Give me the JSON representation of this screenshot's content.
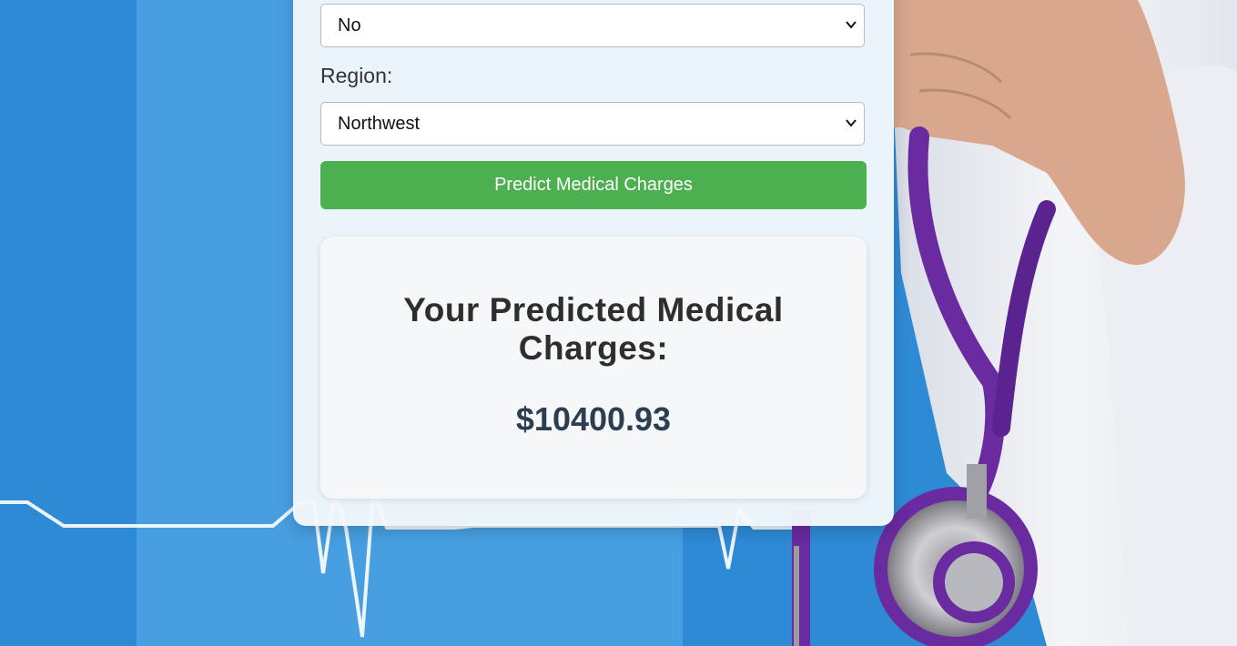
{
  "form": {
    "smoker_value": "No",
    "region_label": "Region:",
    "region_value": "Northwest",
    "predict_label": "Predict Medical Charges"
  },
  "result": {
    "title_line1": "Your Predicted Medical",
    "title_line2": "Charges:",
    "value": "$10400.93"
  },
  "colors": {
    "accent": "#4caf50",
    "background": "#3a96dc",
    "stethoscope": "#6a2aa0"
  },
  "icons": {
    "dropdown": "chevron-down-icon"
  }
}
